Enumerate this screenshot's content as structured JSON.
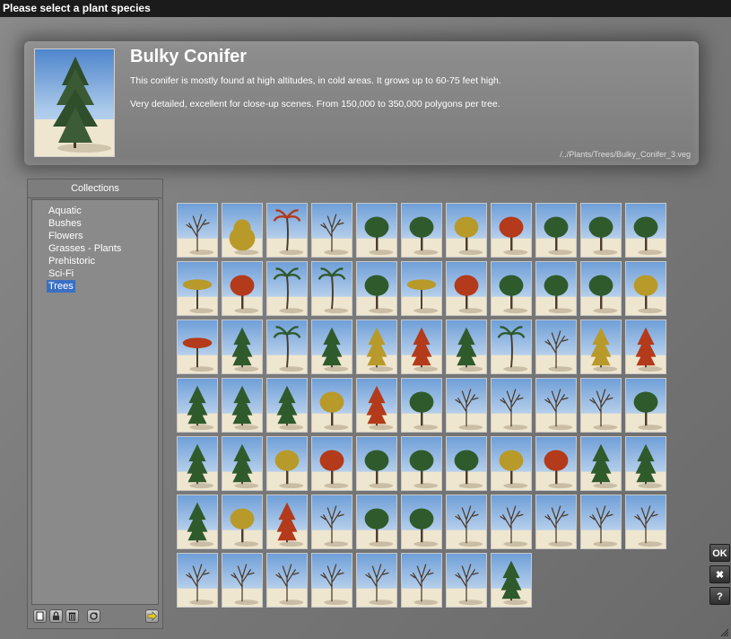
{
  "window": {
    "title": "Please select a plant species"
  },
  "species": {
    "name": "Bulky Conifer",
    "description_1": "This conifer is mostly found at high altitudes, in cold areas. It grows up to 60-75 feet high.",
    "description_2": "Very detailed, excellent for close-up scenes. From 150,000 to 350,000 polygons per tree.",
    "path": "/../Plants/Trees/Bulky_Conifer_3.veg"
  },
  "collections": {
    "header": "Collections",
    "items": [
      {
        "label": "Aquatic",
        "selected": false
      },
      {
        "label": "Bushes",
        "selected": false
      },
      {
        "label": "Flowers",
        "selected": false
      },
      {
        "label": "Grasses - Plants",
        "selected": false
      },
      {
        "label": "Prehistoric",
        "selected": false
      },
      {
        "label": "Sci-Fi",
        "selected": false
      },
      {
        "label": "Trees",
        "selected": true
      }
    ],
    "toolbar": [
      {
        "icon": "new-collection-icon"
      },
      {
        "icon": "lock-icon"
      },
      {
        "icon": "delete-icon"
      },
      {
        "icon": "refresh-icon"
      },
      {
        "icon": "arrow-right-icon"
      }
    ]
  },
  "thumbnails": [
    {
      "shape": "bare"
    },
    {
      "shape": "bush"
    },
    {
      "shape": "palm"
    },
    {
      "shape": "bare"
    },
    {
      "shape": "round"
    },
    {
      "shape": "round"
    },
    {
      "shape": "round"
    },
    {
      "shape": "round"
    },
    {
      "shape": "round"
    },
    {
      "shape": "round"
    },
    {
      "shape": "round"
    },
    {
      "shape": "flat"
    },
    {
      "shape": "round"
    },
    {
      "shape": "palm"
    },
    {
      "shape": "palm"
    },
    {
      "shape": "round"
    },
    {
      "shape": "flat"
    },
    {
      "shape": "round"
    },
    {
      "shape": "round"
    },
    {
      "shape": "round"
    },
    {
      "shape": "round"
    },
    {
      "shape": "round"
    },
    {
      "shape": "flat"
    },
    {
      "shape": "cone"
    },
    {
      "shape": "palm"
    },
    {
      "shape": "cone"
    },
    {
      "shape": "cone"
    },
    {
      "shape": "cone"
    },
    {
      "shape": "cone"
    },
    {
      "shape": "palm"
    },
    {
      "shape": "bare"
    },
    {
      "shape": "cone"
    },
    {
      "shape": "cone"
    },
    {
      "shape": "cone"
    },
    {
      "shape": "cone"
    },
    {
      "shape": "cone"
    },
    {
      "shape": "round"
    },
    {
      "shape": "cone"
    },
    {
      "shape": "round"
    },
    {
      "shape": "bare"
    },
    {
      "shape": "bare"
    },
    {
      "shape": "bare"
    },
    {
      "shape": "bare"
    },
    {
      "shape": "round"
    },
    {
      "shape": "cone"
    },
    {
      "shape": "cone"
    },
    {
      "shape": "round"
    },
    {
      "shape": "round"
    },
    {
      "shape": "round"
    },
    {
      "shape": "round"
    },
    {
      "shape": "round"
    },
    {
      "shape": "round"
    },
    {
      "shape": "round"
    },
    {
      "shape": "cone"
    },
    {
      "shape": "cone"
    },
    {
      "shape": "cone"
    },
    {
      "shape": "round"
    },
    {
      "shape": "cone"
    },
    {
      "shape": "bare"
    },
    {
      "shape": "round"
    },
    {
      "shape": "round"
    },
    {
      "shape": "bare"
    },
    {
      "shape": "bare"
    },
    {
      "shape": "bare"
    },
    {
      "shape": "bare"
    },
    {
      "shape": "bare"
    },
    {
      "shape": "bare"
    },
    {
      "shape": "bare"
    },
    {
      "shape": "bare"
    },
    {
      "shape": "bare"
    },
    {
      "shape": "bare"
    },
    {
      "shape": "bare"
    },
    {
      "shape": "bare"
    },
    {
      "shape": "cone"
    }
  ],
  "buttons": {
    "ok": "OK",
    "cancel": "✖",
    "help": "?"
  },
  "colors": {
    "sky": "#6f9fd8",
    "ground": "#efe6cf",
    "foliage_green": "#2f5a2c",
    "foliage_yellow": "#b89a2a",
    "foliage_red": "#b33a1a",
    "trunk": "#4a3a2a",
    "selected": "#3b6fc4"
  }
}
